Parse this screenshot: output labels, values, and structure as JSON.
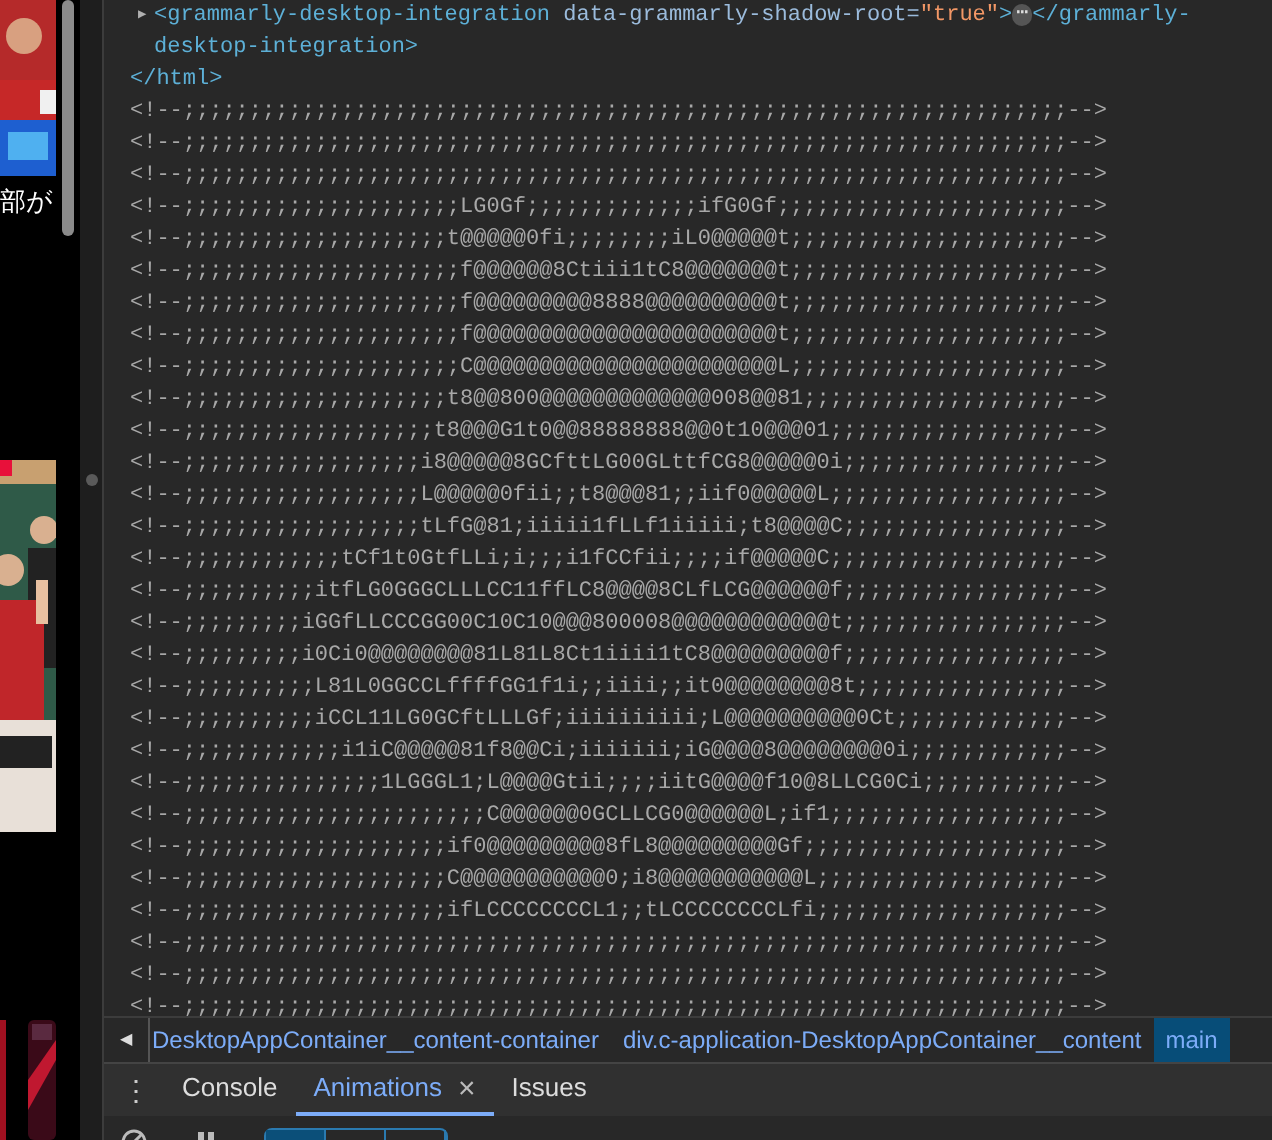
{
  "web_page": {
    "caption": "部が"
  },
  "elements_panel": {
    "dom_lines": [
      {
        "kind": "element",
        "expanded": false,
        "toggle": "▶",
        "open_tag": "<grammarly-desktop-integration",
        "attr_name": "data-grammarly-shadow-root=",
        "attr_value": "\"true\"",
        "open_end": ">",
        "ellipsis": "⋯",
        "close_tag_lines": [
          "</grammarly-",
          "desktop-integration>"
        ]
      },
      {
        "kind": "close",
        "text": "</html>"
      },
      {
        "kind": "comment",
        "text": "<!--;;;;;;;;;;;;;;;;;;;;;;;;;;;;;;;;;;;;;;;;;;;;;;;;;;;;;;;;;;;;;;;;;;;-->"
      },
      {
        "kind": "comment",
        "text": "<!--;;;;;;;;;;;;;;;;;;;;;;;;;;;;;;;;;;;;;;;;;;;;;;;;;;;;;;;;;;;;;;;;;;;-->"
      },
      {
        "kind": "comment",
        "text": "<!--;;;;;;;;;;;;;;;;;;;;;;;;;;;;;;;;;;;;;;;;;;;;;;;;;;;;;;;;;;;;;;;;;;;-->"
      },
      {
        "kind": "comment",
        "text": "<!--;;;;;;;;;;;;;;;;;;;;;LG0Gf;;;;;;;;;;;;;ifG0Gf;;;;;;;;;;;;;;;;;;;;;;-->"
      },
      {
        "kind": "comment",
        "text": "<!--;;;;;;;;;;;;;;;;;;;;t@@@@@0fi;;;;;;;;iL0@@@@@t;;;;;;;;;;;;;;;;;;;;;-->"
      },
      {
        "kind": "comment",
        "text": "<!--;;;;;;;;;;;;;;;;;;;;;f@@@@@@8Ctiii1tC8@@@@@@@t;;;;;;;;;;;;;;;;;;;;;-->"
      },
      {
        "kind": "comment",
        "text": "<!--;;;;;;;;;;;;;;;;;;;;;f@@@@@@@@@8888@@@@@@@@@@t;;;;;;;;;;;;;;;;;;;;;-->"
      },
      {
        "kind": "comment",
        "text": "<!--;;;;;;;;;;;;;;;;;;;;;f@@@@@@@@@@@@@@@@@@@@@@@t;;;;;;;;;;;;;;;;;;;;;-->"
      },
      {
        "kind": "comment",
        "text": "<!--;;;;;;;;;;;;;;;;;;;;;C@@@@@@@@@@@@@@@@@@@@@@@L;;;;;;;;;;;;;;;;;;;;;-->"
      },
      {
        "kind": "comment",
        "text": "<!--;;;;;;;;;;;;;;;;;;;;t8@@800@@@@@@@@@@@@@008@@81;;;;;;;;;;;;;;;;;;;;-->"
      },
      {
        "kind": "comment",
        "text": "<!--;;;;;;;;;;;;;;;;;;;t8@@@G1t0@@88888888@@0t10@@@01;;;;;;;;;;;;;;;;;;-->"
      },
      {
        "kind": "comment",
        "text": "<!--;;;;;;;;;;;;;;;;;;i8@@@@@8GCfttLG00GLttfCG8@@@@@0i;;;;;;;;;;;;;;;;;-->"
      },
      {
        "kind": "comment",
        "text": "<!--;;;;;;;;;;;;;;;;;;L@@@@@0fii;;t8@@@81;;iif0@@@@@L;;;;;;;;;;;;;;;;;;-->"
      },
      {
        "kind": "comment",
        "text": "<!--;;;;;;;;;;;;;;;;;;tLfG@81;iiiii1fLLf1iiiii;t8@@@@C;;;;;;;;;;;;;;;;;-->"
      },
      {
        "kind": "comment",
        "text": "<!--;;;;;;;;;;;;tCf1t0GtfLLi;i;;;i1fCCfii;;;;if@@@@@C;;;;;;;;;;;;;;;;;;-->"
      },
      {
        "kind": "comment",
        "text": "<!--;;;;;;;;;;itfLG0GGGCLLLCC11ffLC8@@@@8CLfLCG@@@@@@f;;;;;;;;;;;;;;;;;-->"
      },
      {
        "kind": "comment",
        "text": "<!--;;;;;;;;;iGGfLLCCCGG00C10C10@@@800008@@@@@@@@@@@@t;;;;;;;;;;;;;;;;;-->"
      },
      {
        "kind": "comment",
        "text": "<!--;;;;;;;;;i0Ci0@@@@@@@@81L81L8Ct1iiii1tC8@@@@@@@@@f;;;;;;;;;;;;;;;;;-->"
      },
      {
        "kind": "comment",
        "text": "<!--;;;;;;;;;;L81L0GGCCLffffGG1f1i;;iiii;;it0@@@@@@@@8t;;;;;;;;;;;;;;;;-->"
      },
      {
        "kind": "comment",
        "text": "<!--;;;;;;;;;;iCCL11LG0GCftLLLGf;iiiiiiiiii;L@@@@@@@@@@0Ct;;;;;;;;;;;;;-->"
      },
      {
        "kind": "comment",
        "text": "<!--;;;;;;;;;;;;i1iC@@@@@81f8@@Ci;iiiiiii;iG@@@@8@@@@@@@@0i;;;;;;;;;;;;-->"
      },
      {
        "kind": "comment",
        "text": "<!--;;;;;;;;;;;;;;;1LGGGL1;L@@@@Gtii;;;;iitG@@@@f10@8LLCG0Ci;;;;;;;;;;;-->"
      },
      {
        "kind": "comment",
        "text": "<!--;;;;;;;;;;;;;;;;;;;;;;;C@@@@@@0GCLLCG0@@@@@@L;if1;;;;;;;;;;;;;;;;;;-->"
      },
      {
        "kind": "comment",
        "text": "<!--;;;;;;;;;;;;;;;;;;;;if0@@@@@@@@@8fL8@@@@@@@@@Gf;;;;;;;;;;;;;;;;;;;;-->"
      },
      {
        "kind": "comment",
        "text": "<!--;;;;;;;;;;;;;;;;;;;;C@@@@@@@@@@@0;i8@@@@@@@@@@@L;;;;;;;;;;;;;;;;;;;-->"
      },
      {
        "kind": "comment",
        "text": "<!--;;;;;;;;;;;;;;;;;;;;ifLCCCCCCCCL1;;tLCCCCCCCCLfi;;;;;;;;;;;;;;;;;;;-->"
      },
      {
        "kind": "comment",
        "text": "<!--;;;;;;;;;;;;;;;;;;;;;;;;;;;;;;;;;;;;;;;;;;;;;;;;;;;;;;;;;;;;;;;;;;;-->"
      },
      {
        "kind": "comment",
        "text": "<!--;;;;;;;;;;;;;;;;;;;;;;;;;;;;;;;;;;;;;;;;;;;;;;;;;;;;;;;;;;;;;;;;;;;-->"
      },
      {
        "kind": "comment",
        "text": "<!--;;;;;;;;;;;;;;;;;;;;;;;;;;;;;;;;;;;;;;;;;;;;;;;;;;;;;;;;;;;;;;;;;;;-->"
      }
    ]
  },
  "breadcrumbs": {
    "scroll_left": "◀",
    "items": [
      {
        "label": "DesktopAppContainer__content-container",
        "selected": false
      },
      {
        "label": "div.c-application-DesktopAppContainer__content",
        "selected": false
      },
      {
        "label": "main",
        "selected": true
      }
    ]
  },
  "drawer": {
    "menu": "⋮",
    "tabs": [
      {
        "label": "Console",
        "selected": false
      },
      {
        "label": "Animations",
        "selected": true,
        "close": "×"
      },
      {
        "label": "Issues",
        "selected": false
      }
    ]
  },
  "animation_toolbar": {
    "speed_buttons": [
      {
        "selected": true
      },
      {
        "selected": false
      },
      {
        "selected": false
      }
    ]
  }
}
